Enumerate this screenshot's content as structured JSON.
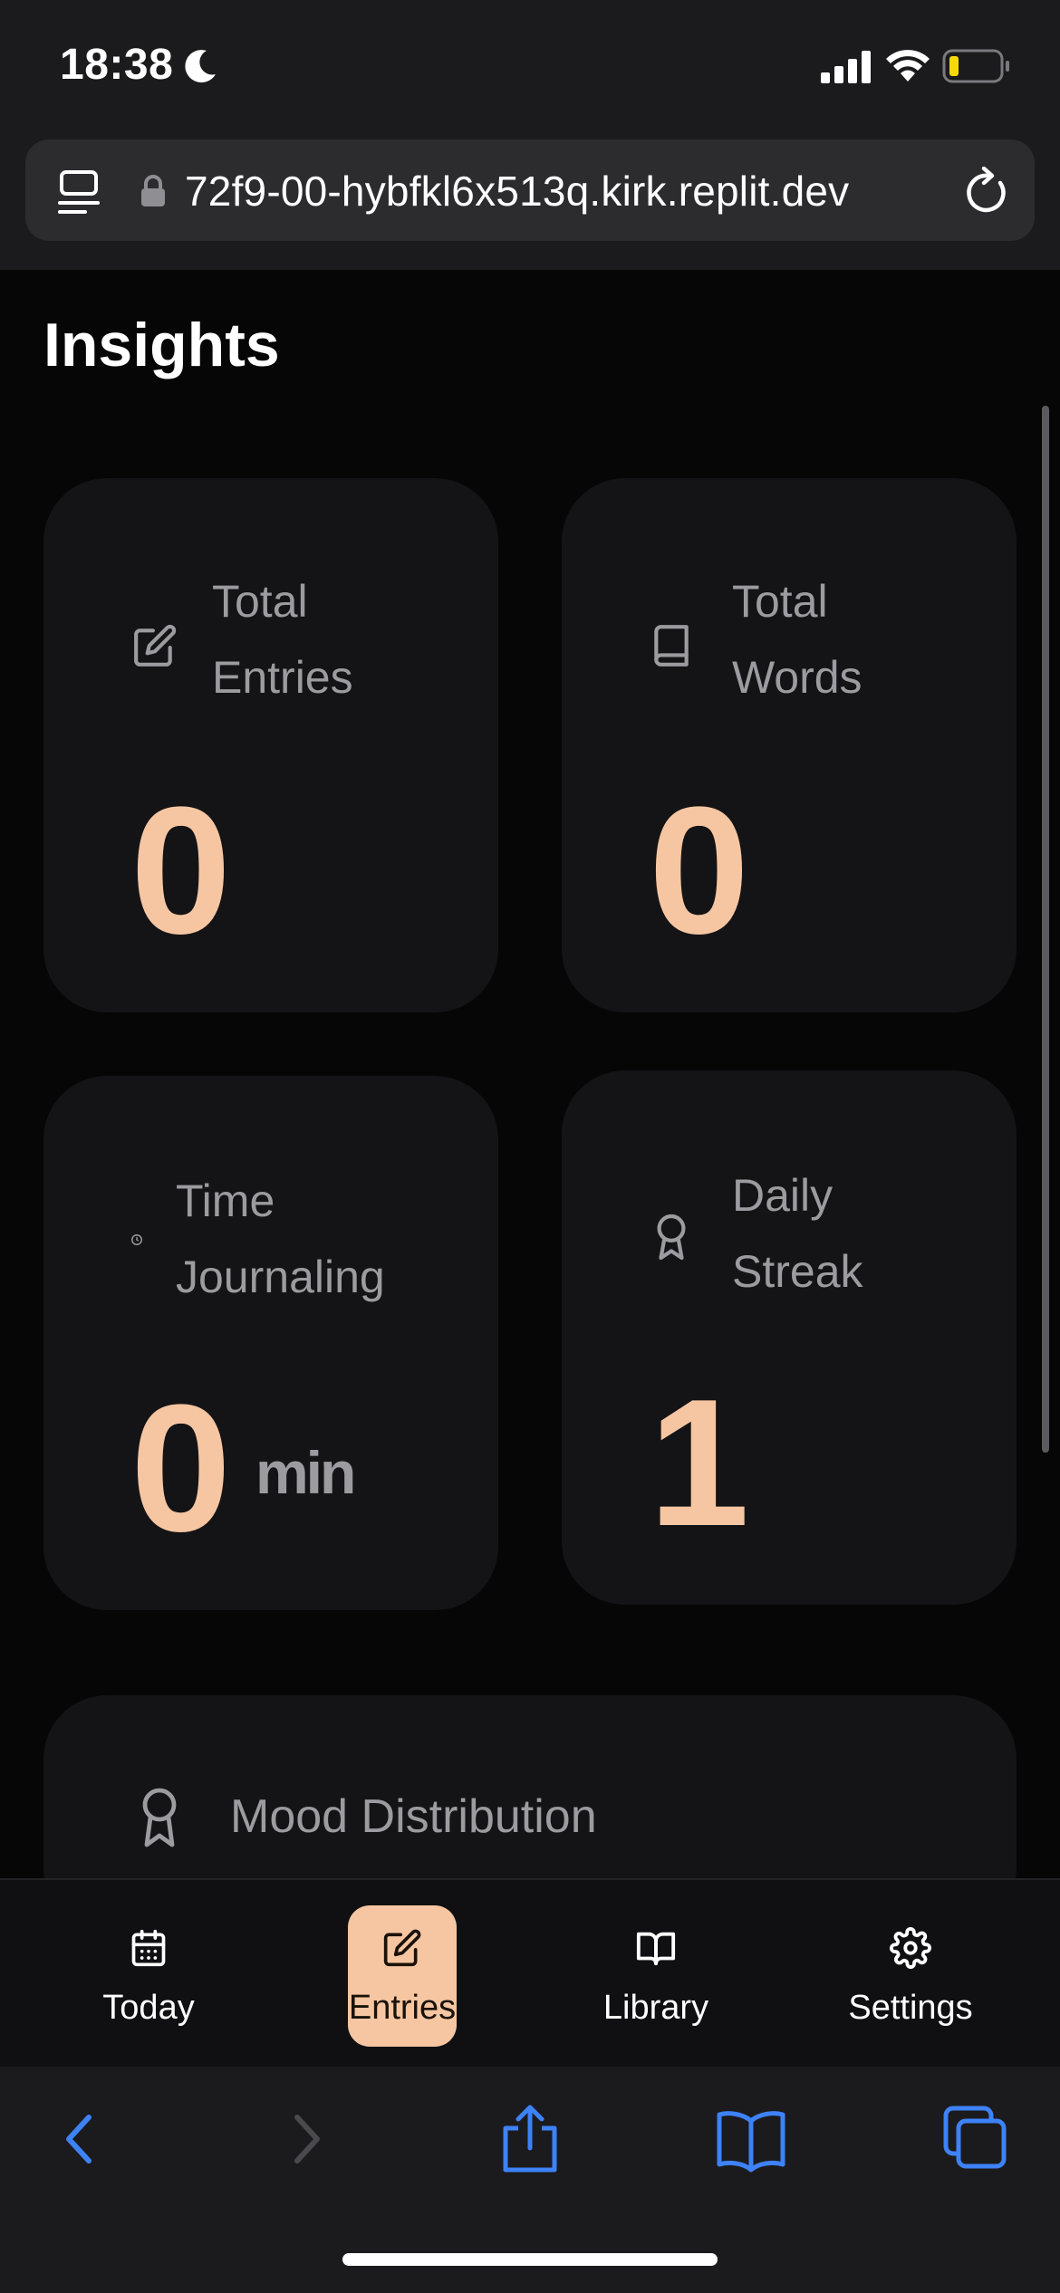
{
  "status_bar": {
    "time": "18:38",
    "icons": [
      "moon-icon",
      "signal-icon",
      "wifi-icon",
      "battery-icon"
    ]
  },
  "browser": {
    "url": "72f9-00-hybfkl6x513q.kirk.replit.dev",
    "icons": [
      "reader-icon",
      "lock-icon",
      "reload-icon"
    ],
    "toolbar": [
      "back-icon",
      "forward-icon",
      "share-icon",
      "bookmarks-icon",
      "tabs-icon"
    ]
  },
  "page": {
    "title": "Insights"
  },
  "stats": {
    "total_entries": {
      "label_line1": "Total",
      "label_line2": "Entries",
      "value": "0",
      "icon": "edit-icon"
    },
    "total_words": {
      "label_line1": "Total",
      "label_line2": "Words",
      "value": "0",
      "icon": "book-icon"
    },
    "time_journaling": {
      "label_line1": "Time",
      "label_line2": "Journaling",
      "value": "0",
      "unit": "min",
      "icon": "clock-icon"
    },
    "daily_streak": {
      "label_line1": "Daily",
      "label_line2": "Streak",
      "value": "1",
      "icon": "award-icon"
    }
  },
  "mood": {
    "title": "Mood Distribution",
    "icon": "award-icon"
  },
  "nav": {
    "items": [
      {
        "label": "Today",
        "icon": "calendar-icon"
      },
      {
        "label": "Entries",
        "icon": "edit-icon",
        "active": true
      },
      {
        "label": "Library",
        "icon": "book-open-icon"
      },
      {
        "label": "Settings",
        "icon": "gear-icon"
      }
    ]
  },
  "colors": {
    "accent": "#f6c6a2",
    "card_bg": "#141416",
    "label_gray": "#9b9ba0",
    "safari_blue": "#3e82f7",
    "battery_low": "#f5d90a"
  }
}
